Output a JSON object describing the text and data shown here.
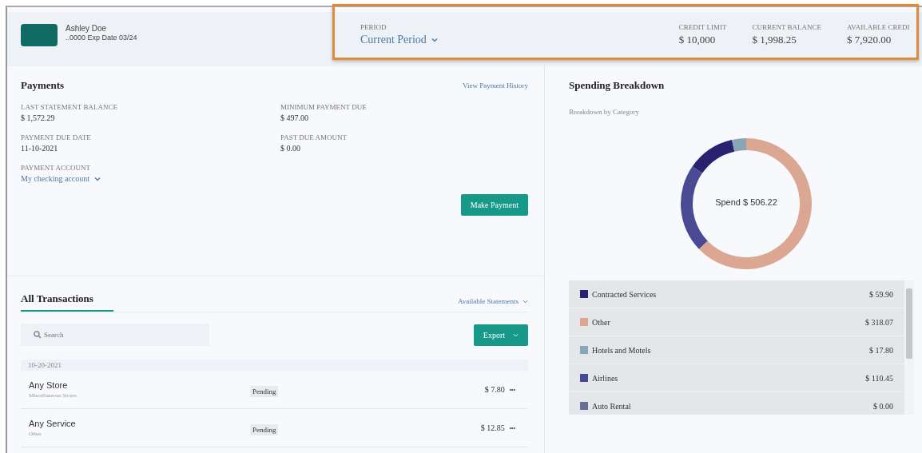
{
  "card": {
    "holder": "Ashley Doe",
    "details": "..0000 Exp Date 03/24"
  },
  "summary": {
    "period": {
      "label": "PERIOD",
      "value": "Current Period"
    },
    "stats": [
      {
        "label": "CREDIT LIMIT",
        "value": "$ 10,000"
      },
      {
        "label": "CURRENT BALANCE",
        "value": "$ 1,998.25"
      },
      {
        "label": "AVAILABLE CREDI",
        "value": "$ 7,920.00"
      }
    ]
  },
  "payments": {
    "title": "Payments",
    "history_link": "View Payment History",
    "fields": [
      {
        "label": "LAST STATEMENT BALANCE",
        "value": "$ 1,572.29"
      },
      {
        "label": "MINIMUM PAYMENT DUE",
        "value": "$ 497.00"
      },
      {
        "label": "PAYMENT DUE DATE",
        "value": "11-10-2021"
      },
      {
        "label": "PAST DUE AMOUNT",
        "value": "$ 0.00"
      }
    ],
    "account": {
      "label": "PAYMENT ACCOUNT",
      "value": "My checking account"
    },
    "button": "Make Payment"
  },
  "transactions": {
    "tabs": [
      {
        "label": "All Transactions",
        "selected": true
      }
    ],
    "statements_link": "Available Statements",
    "search": {
      "placeholder": "Search"
    },
    "export_button": "Export",
    "date": "10-20-2021",
    "rows": [
      {
        "name": "Any Store",
        "category": "Miscellaneous Stores",
        "status": "Pending",
        "amount": "$ 7.80",
        "menu": "•••"
      },
      {
        "name": "Any Service",
        "category": "Other",
        "status": "Pending",
        "amount": "$ 12.85",
        "menu": "•••"
      }
    ]
  },
  "spending": {
    "title": "Spending Breakdown",
    "subtitle": "Breakdown by Category",
    "center_label": "Spend $ 506.22",
    "chart_data": {
      "type": "donut",
      "categories": [
        "Contracted Services",
        "Other",
        "Hotels and Motels",
        "Airlines",
        "Auto Rental"
      ],
      "series": [
        {
          "values": [
            11.83,
            62.83,
            3.52,
            21.82,
            0
          ]
        }
      ],
      "colors": [
        "#2a2170",
        "#dba792",
        "#8aa5b5",
        "#4a4a94",
        "#6a6f96"
      ]
    },
    "legend": [
      {
        "amount": "$ 59.90"
      },
      {
        "amount": "$ 318.07"
      },
      {
        "amount": "$ 17.80"
      },
      {
        "amount": "$ 110.45"
      },
      {
        "amount": "$ 0.00"
      }
    ]
  }
}
